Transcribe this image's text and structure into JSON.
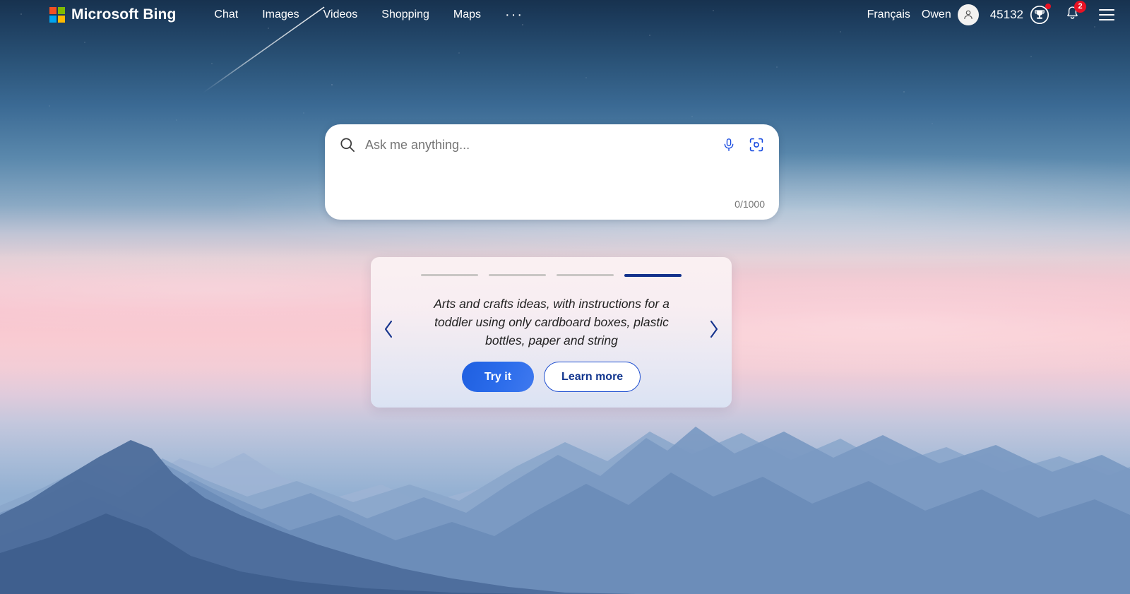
{
  "header": {
    "brand": "Microsoft Bing",
    "logo_colors": {
      "top_left": "#f25022",
      "top_right": "#7fba00",
      "bottom_left": "#00a4ef",
      "bottom_right": "#ffb900"
    },
    "nav": [
      {
        "label": "Chat",
        "name": "nav-chat"
      },
      {
        "label": "Images",
        "name": "nav-images"
      },
      {
        "label": "Videos",
        "name": "nav-videos"
      },
      {
        "label": "Shopping",
        "name": "nav-shopping"
      },
      {
        "label": "Maps",
        "name": "nav-maps"
      }
    ],
    "more_label": "···",
    "language": "Français",
    "user_name": "Owen",
    "rewards_points": "45132",
    "notification_count": "2"
  },
  "search": {
    "placeholder": "Ask me anything...",
    "value": "",
    "counter": "0/1000",
    "icons": {
      "search": "search-icon",
      "microphone": "microphone-icon",
      "visual_search": "camera-visual-search-icon"
    }
  },
  "suggestion_card": {
    "indicators": [
      {
        "active": false
      },
      {
        "active": false
      },
      {
        "active": false
      },
      {
        "active": true
      }
    ],
    "text": "Arts and crafts ideas, with instructions for a toddler using only cardboard boxes, plastic bottles, paper and string",
    "primary_button": "Try it",
    "secondary_button": "Learn more",
    "prev_label": "‹",
    "next_label": "›"
  },
  "theme": {
    "accent_blue": "#1f5fe0",
    "active_indicator": "#14328c",
    "badge_red": "#e81123",
    "inactive_indicator": "#c9c6c4"
  }
}
